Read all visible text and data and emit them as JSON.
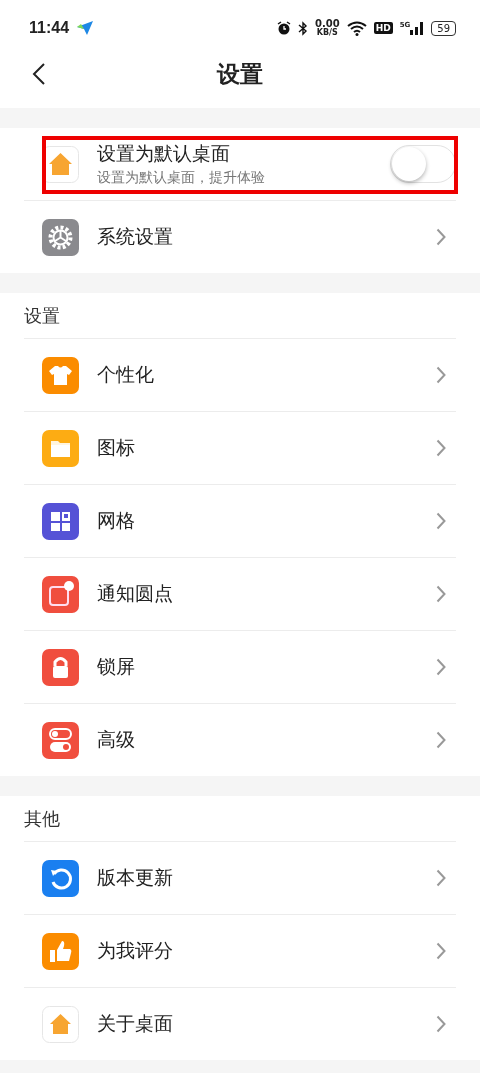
{
  "status_bar": {
    "time": "11:44",
    "speed": "0.00",
    "speed_unit": "KB/S",
    "hd": "HD",
    "network": "5G",
    "battery": "59"
  },
  "header": {
    "title": "设置"
  },
  "top_group": [
    {
      "kind": "toggle",
      "title": "设置为默认桌面",
      "subtitle": "设置为默认桌面，提升体验",
      "on": false,
      "highlighted": true
    },
    {
      "kind": "link",
      "title": "系统设置"
    }
  ],
  "sections": [
    {
      "title": "设置",
      "items": [
        {
          "kind": "link",
          "title": "个性化"
        },
        {
          "kind": "link",
          "title": "图标"
        },
        {
          "kind": "link",
          "title": "网格"
        },
        {
          "kind": "link",
          "title": "通知圆点"
        },
        {
          "kind": "link",
          "title": "锁屏"
        },
        {
          "kind": "link",
          "title": "高级"
        }
      ]
    },
    {
      "title": "其他",
      "items": [
        {
          "kind": "link",
          "title": "版本更新"
        },
        {
          "kind": "link",
          "title": "为我评分"
        },
        {
          "kind": "link",
          "title": "关于桌面"
        }
      ]
    }
  ]
}
